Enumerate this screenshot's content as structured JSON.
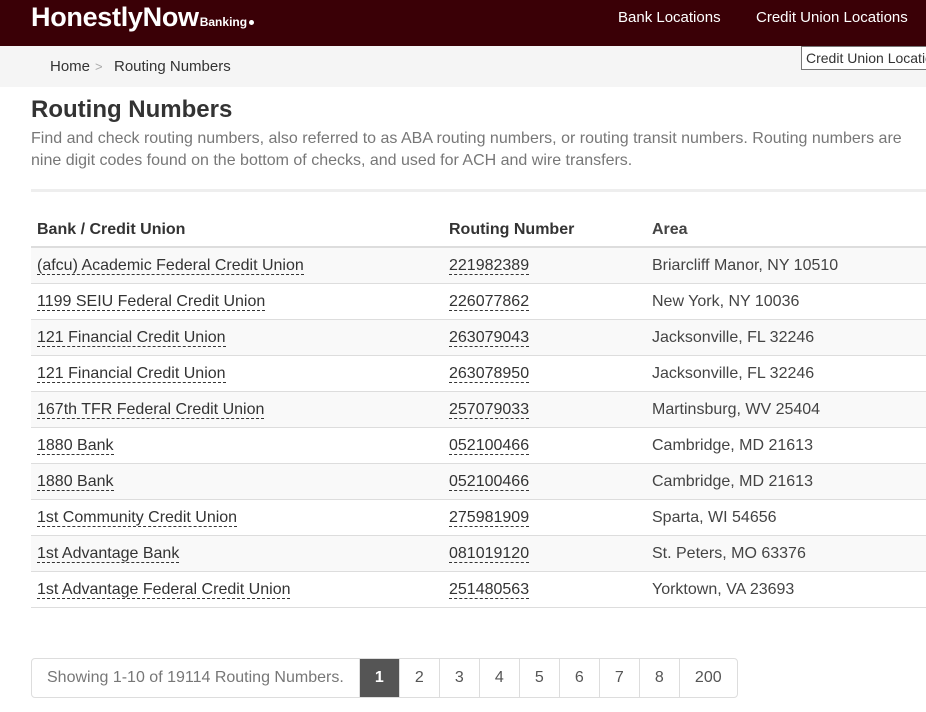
{
  "header": {
    "brand_main": "HonestlyNow",
    "brand_sub": "Banking",
    "nav": [
      "Bank Locations",
      "Credit Union Locations"
    ]
  },
  "tooltip": "Credit Union Locations",
  "breadcrumb": {
    "home": "Home",
    "separator": ">",
    "current": "Routing Numbers"
  },
  "page": {
    "title": "Routing Numbers",
    "description": "Find and check routing numbers, also referred to as ABA routing numbers, or routing transit numbers. Routing numbers are nine digit codes found on the bottom of checks, and used for ACH and wire transfers."
  },
  "table": {
    "headers": [
      "Bank / Credit Union",
      "Routing Number",
      "Area"
    ],
    "rows": [
      [
        "(afcu) Academic Federal Credit Union",
        "221982389",
        "Briarcliff Manor, NY 10510"
      ],
      [
        "1199 SEIU Federal Credit Union",
        "226077862",
        "New York, NY 10036"
      ],
      [
        "121 Financial Credit Union",
        "263079043",
        "Jacksonville, FL 32246"
      ],
      [
        "121 Financial Credit Union",
        "263078950",
        "Jacksonville, FL 32246"
      ],
      [
        "167th TFR Federal Credit Union",
        "257079033",
        "Martinsburg, WV 25404"
      ],
      [
        "1880 Bank",
        "052100466",
        "Cambridge, MD 21613"
      ],
      [
        "1880 Bank",
        "052100466",
        "Cambridge, MD 21613"
      ],
      [
        "1st Community Credit Union",
        "275981909",
        "Sparta, WI 54656"
      ],
      [
        "1st Advantage Bank",
        "081019120",
        "St. Peters, MO 63376"
      ],
      [
        "1st Advantage Federal Credit Union",
        "251480563",
        "Yorktown, VA 23693"
      ]
    ]
  },
  "pagination": {
    "info": "Showing 1-10 of 19114 Routing Numbers.",
    "pages": [
      "1",
      "2",
      "3",
      "4",
      "5",
      "6",
      "7",
      "8",
      "200"
    ],
    "active": "1"
  },
  "colors": {
    "header_bg": "#3a0006",
    "active_page_bg": "#555555"
  }
}
